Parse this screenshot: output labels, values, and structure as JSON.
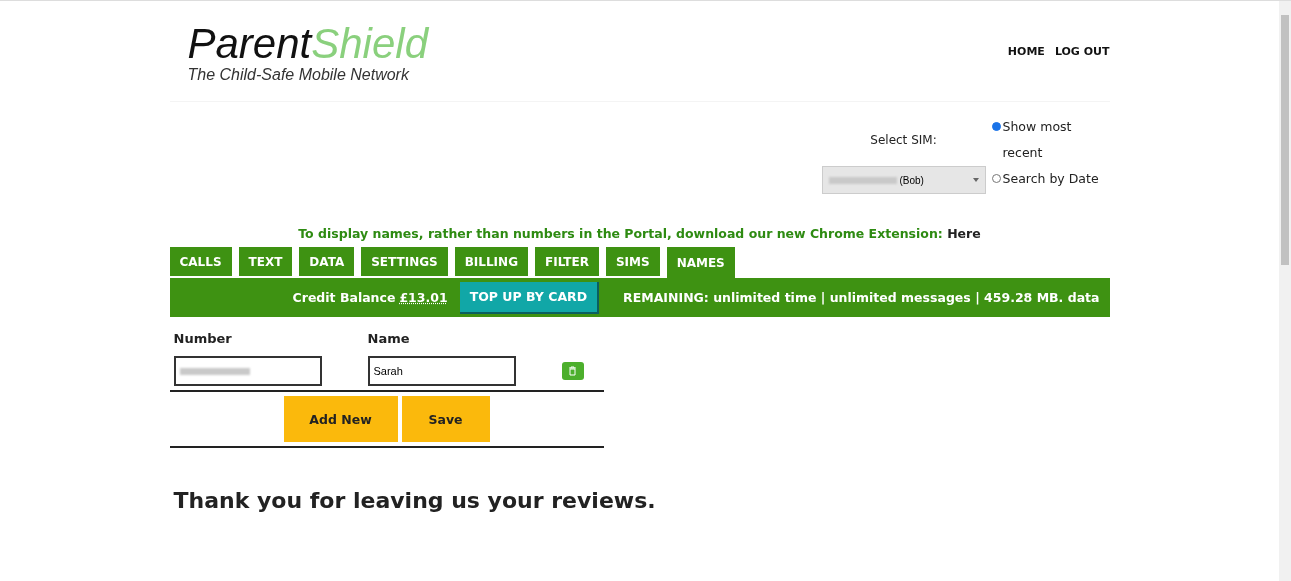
{
  "header": {
    "logo": {
      "part1": "Parent",
      "part2": "Shield",
      "tagline": "The Child-Safe Mobile Network"
    },
    "nav": [
      "HOME",
      "LOG OUT"
    ]
  },
  "sim": {
    "label": "Select SIM:",
    "selected_name": "(Bob)",
    "options": [
      {
        "label": "Show most recent",
        "selected": true
      },
      {
        "label": "Search by Date",
        "selected": false
      }
    ]
  },
  "notice": {
    "text": "To display names, rather than numbers in the Portal, download our new Chrome Extension:",
    "link": "Here"
  },
  "tabs": [
    {
      "label": "CALLS",
      "selected": false
    },
    {
      "label": "TEXT",
      "selected": false
    },
    {
      "label": "DATA",
      "selected": false
    },
    {
      "label": "SETTINGS",
      "selected": false
    },
    {
      "label": "BILLING",
      "selected": false
    },
    {
      "label": "FILTER",
      "selected": false
    },
    {
      "label": "SIMS",
      "selected": false
    },
    {
      "label": "NAMES",
      "selected": true
    }
  ],
  "balance_bar": {
    "label": "Credit Balance",
    "amount": "£13.01",
    "top_up": "TOP UP BY CARD",
    "remaining": "REMAINING: unlimited time | unlimited messages | 459.28 MB. data"
  },
  "names_table": {
    "columns": [
      "Number",
      "Name"
    ],
    "rows": [
      {
        "name": "Sarah"
      }
    ],
    "buttons": [
      "Add New",
      "Save"
    ]
  },
  "reviews_heading": "Thank you for leaving us your reviews."
}
